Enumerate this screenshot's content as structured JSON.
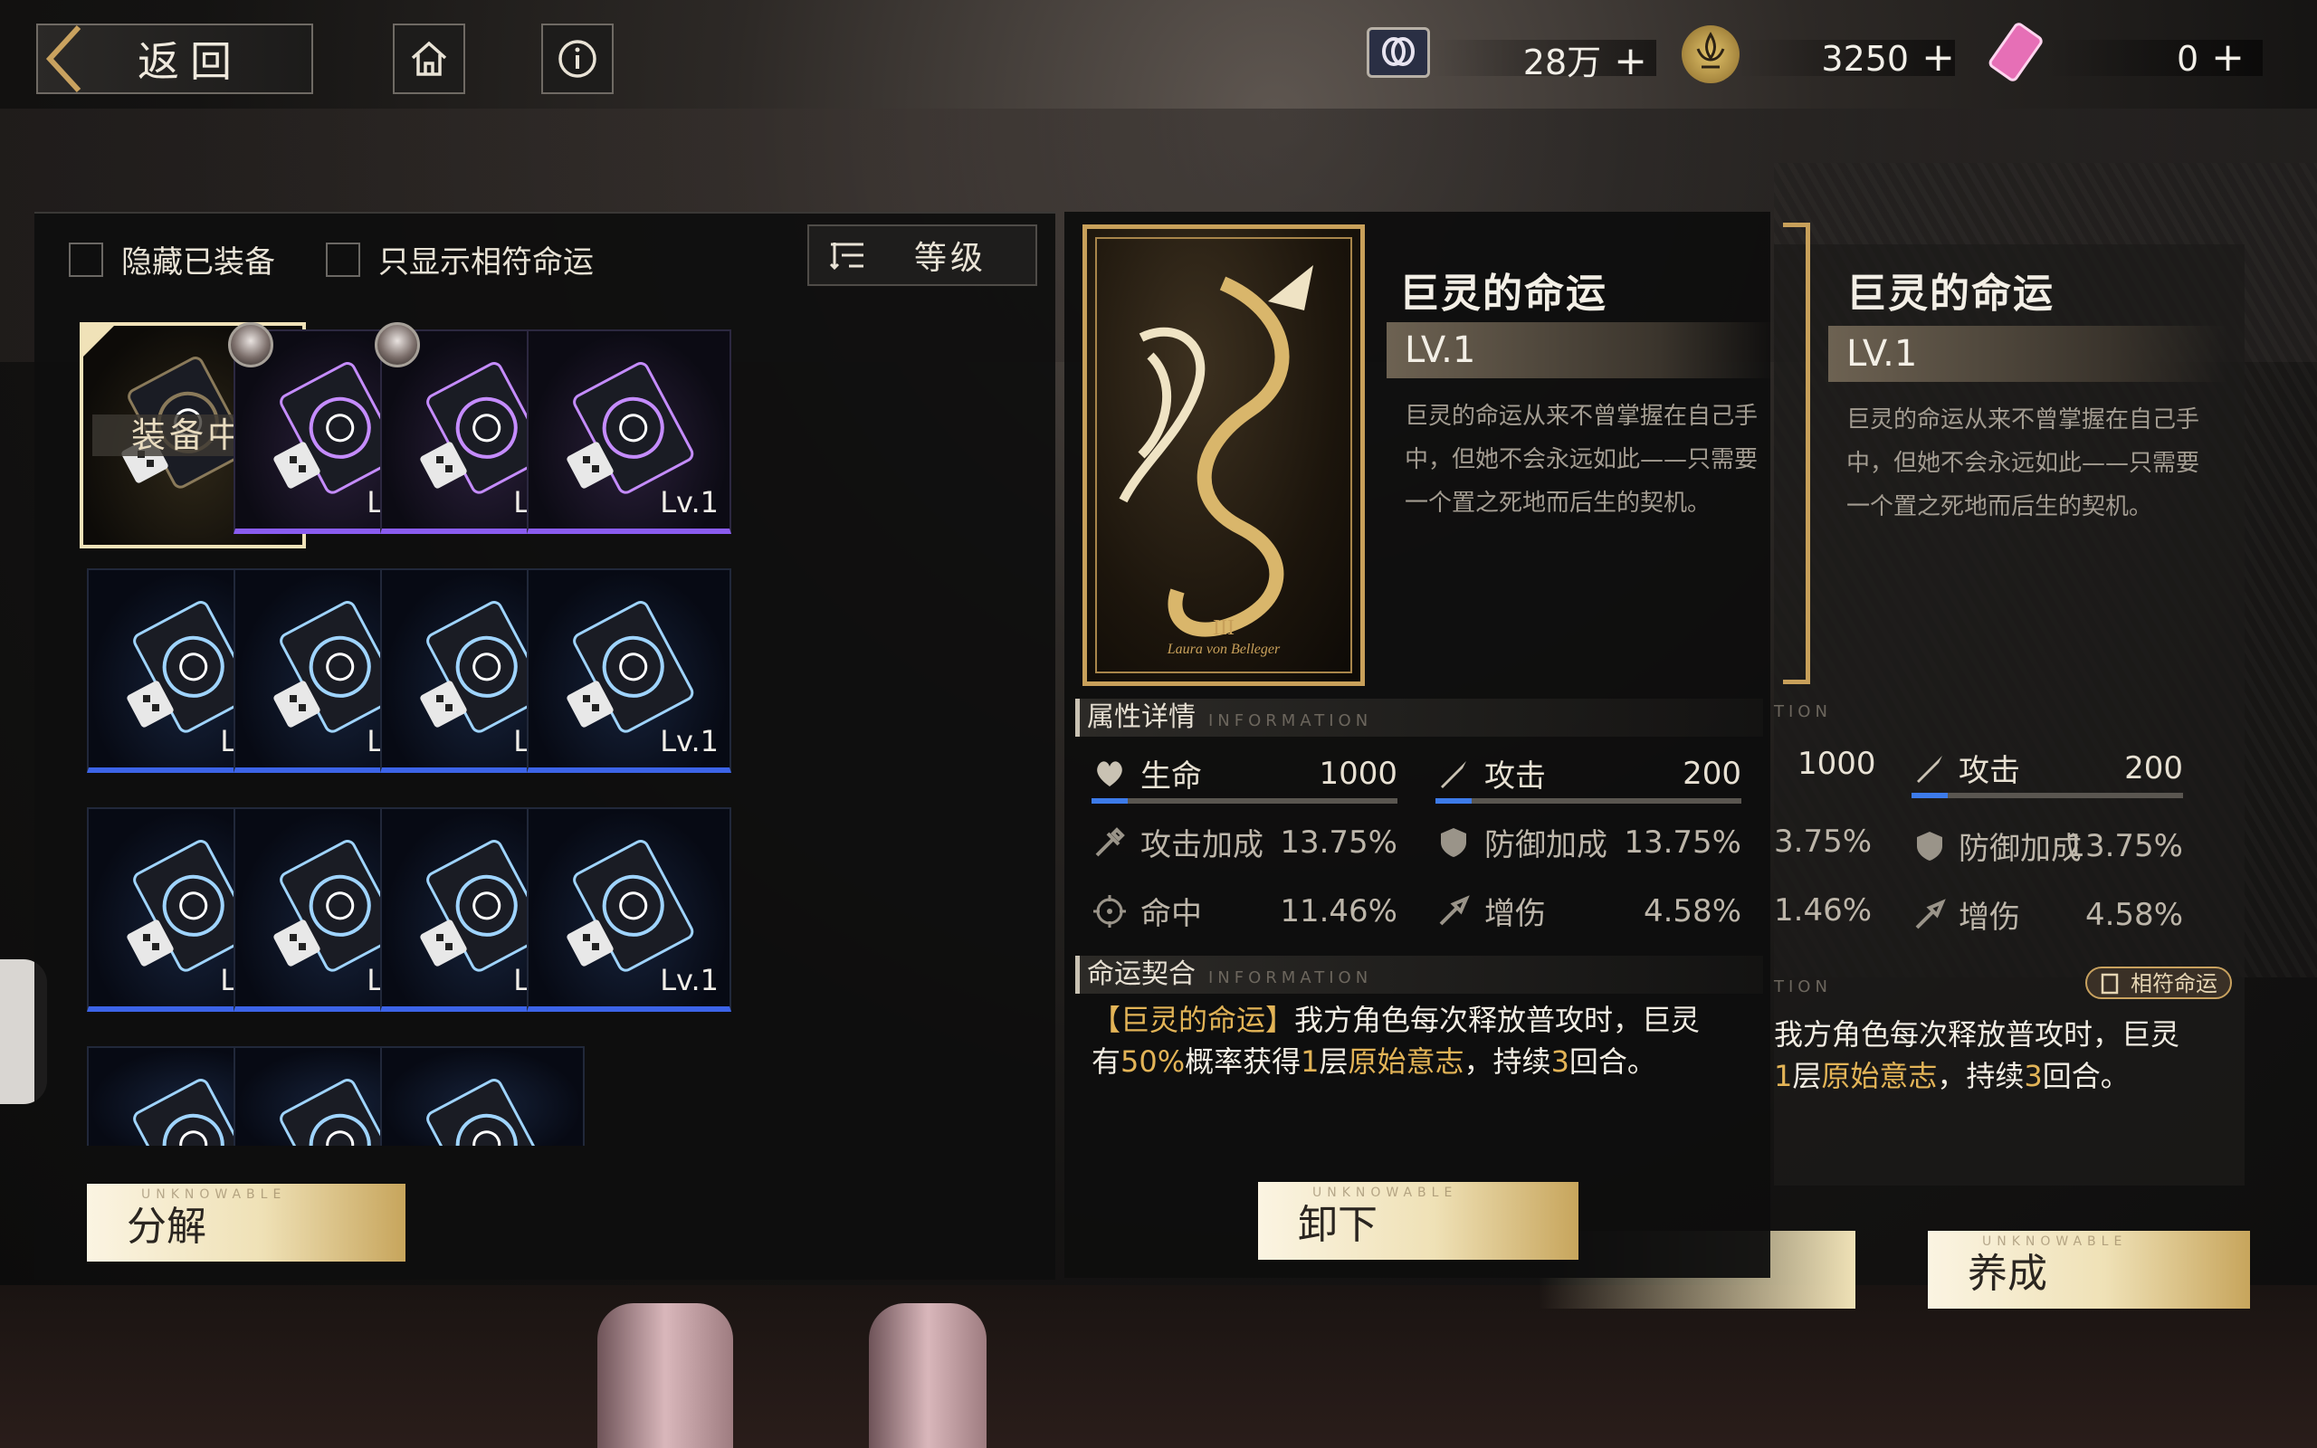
{
  "header": {
    "back_label": "返回",
    "currencies": [
      {
        "name": "credit",
        "value": "28万",
        "icon": "ticket-coin-icon"
      },
      {
        "name": "gold",
        "value": "3250",
        "icon": "fleur-de-lis-icon"
      },
      {
        "name": "ticket",
        "value": "0",
        "icon": "pink-ticket-icon"
      }
    ],
    "plus": "+"
  },
  "filters": {
    "hide_equipped": "隐藏已装备",
    "show_matching": "只显示相符命运",
    "sort_label": "等级"
  },
  "inventory": {
    "equipped_tag": "装备中",
    "slots": [
      {
        "lv": "Lv.1",
        "rarity": "gold",
        "equipped": true
      },
      {
        "lv": "Lv.1",
        "rarity": "purple",
        "avatar": true
      },
      {
        "lv": "Lv.1",
        "rarity": "purple",
        "avatar": true
      },
      {
        "lv": "Lv.1",
        "rarity": "purple"
      },
      {
        "lv": "Lv.1",
        "rarity": "blue"
      },
      {
        "lv": "Lv.1",
        "rarity": "blue"
      },
      {
        "lv": "Lv.1",
        "rarity": "blue"
      },
      {
        "lv": "Lv.1",
        "rarity": "blue"
      },
      {
        "lv": "Lv.1",
        "rarity": "blue"
      },
      {
        "lv": "Lv.1",
        "rarity": "blue"
      },
      {
        "lv": "Lv.1",
        "rarity": "blue"
      },
      {
        "lv": "Lv.1",
        "rarity": "blue"
      },
      {
        "lv": "",
        "rarity": "blue"
      },
      {
        "lv": "",
        "rarity": "blue"
      },
      {
        "lv": "",
        "rarity": "blue"
      }
    ],
    "decompose_label": "分解",
    "brand_small": "UNKNOWABLE"
  },
  "detail": {
    "name": "巨灵的命运",
    "level": "LV.1",
    "description": "巨灵的命运从来不曾掌握在自己手中，但她不会永远如此——只需要一个置之死地而后生的契机。",
    "card_caption": "Laura von Belleger",
    "card_numeral": "III",
    "attr_title": "属性详情",
    "attr_en": "INFORMATION",
    "stats": [
      {
        "icon": "heart-icon",
        "label": "生命",
        "value": "1000"
      },
      {
        "icon": "sword-icon",
        "label": "攻击",
        "value": "200"
      },
      {
        "icon": "attack-bonus-icon",
        "label": "攻击加成",
        "value": "13.75%"
      },
      {
        "icon": "shield-icon",
        "label": "防御加成",
        "value": "13.75%"
      },
      {
        "icon": "crosshair-icon",
        "label": "命中",
        "value": "11.46%"
      },
      {
        "icon": "damage-up-icon",
        "label": "增伤",
        "value": "4.58%"
      }
    ],
    "fate_title": "命运契合",
    "fate_en": "INFORMATION",
    "effect_line1_tag": "【巨灵的命运】",
    "effect_line1_rest": "我方角色每次释放普攻时，巨灵",
    "effect_l2_a": "有",
    "effect_l2_b": "50%",
    "effect_l2_c": "概率获得",
    "effect_l2_d": "1",
    "effect_l2_e": "层",
    "effect_l2_f": "原始意志",
    "effect_l2_g": "，持续",
    "effect_l2_h": "3",
    "effect_l2_i": "回合。",
    "unequip_label": "卸下"
  },
  "echo": {
    "name": "巨灵的命运",
    "level": "LV.1",
    "description": "巨灵的命运从来不曾掌握在自己手中，但她不会永远如此——只需要一个置之死地而后生的契机。",
    "stat_hp_value": "1000",
    "stat_atk_label": "攻击",
    "stat_atk_value": "200",
    "stat_atkbonus_value": "3.75%",
    "stat_def_label": "防御加成",
    "stat_def_value": "13.75%",
    "stat_hit_value": "1.46%",
    "stat_dmg_label": "增伤",
    "stat_dmg_value": "4.58%",
    "attr_en_partial": "TION",
    "fate_en_partial": "TION",
    "match_pill": "相符命运",
    "effect_line1": "我方角色每次释放普攻时，巨灵",
    "effect_l2_a": "1",
    "effect_l2_b": "层",
    "effect_l2_c": "原始意志",
    "effect_l2_d": "，持续",
    "effect_l2_e": "3",
    "effect_l2_f": "回合。",
    "train_label": "养成"
  }
}
